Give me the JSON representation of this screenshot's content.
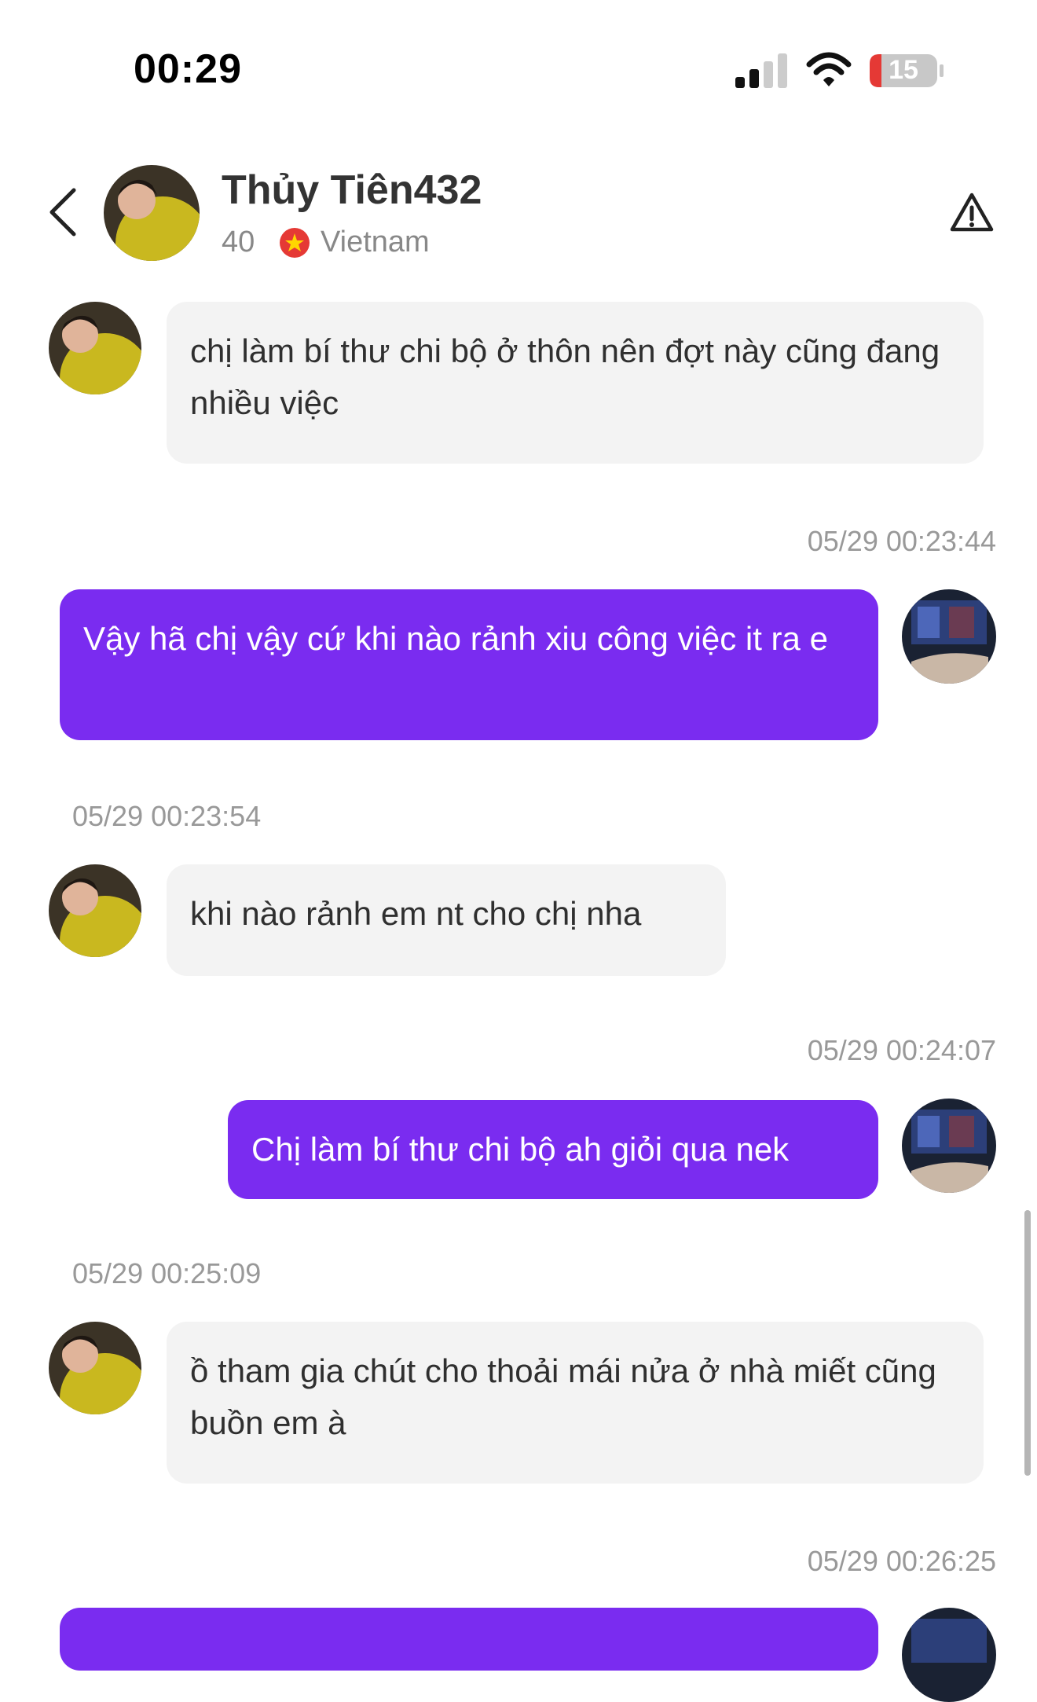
{
  "status_bar": {
    "time": "00:29",
    "battery": "15"
  },
  "header": {
    "name": "Thủy Tiên432",
    "age": "40",
    "country": "Vietnam",
    "back_icon": "chevron-left-icon",
    "report_icon": "warning-icon"
  },
  "messages": [
    {
      "direction": "in",
      "text": "chị làm bí thư chi bộ ở thôn nên đợt này cũng đang nhiều việc"
    },
    {
      "direction": "out",
      "timestamp": "05/29 00:23:44",
      "text": "Vậy hã chị vậy cứ khi nào rảnh xiu công việc it ra e"
    },
    {
      "direction": "in",
      "timestamp": "05/29 00:23:54",
      "text": "khi nào rảnh em nt cho chị nha"
    },
    {
      "direction": "out",
      "timestamp": "05/29 00:24:07",
      "text": "Chị làm bí thư chi bộ ah giỏi qua nek"
    },
    {
      "direction": "in",
      "timestamp": "05/29 00:25:09",
      "text": "ồ tham gia chút cho thoải mái nửa ở nhà miết cũng buồn em à"
    },
    {
      "direction": "out",
      "timestamp": "05/29 00:26:25",
      "text": ""
    }
  ],
  "colors": {
    "accent": "#7a2cf0",
    "incoming_bubble": "#f3f3f3",
    "timestamp": "#999999"
  }
}
